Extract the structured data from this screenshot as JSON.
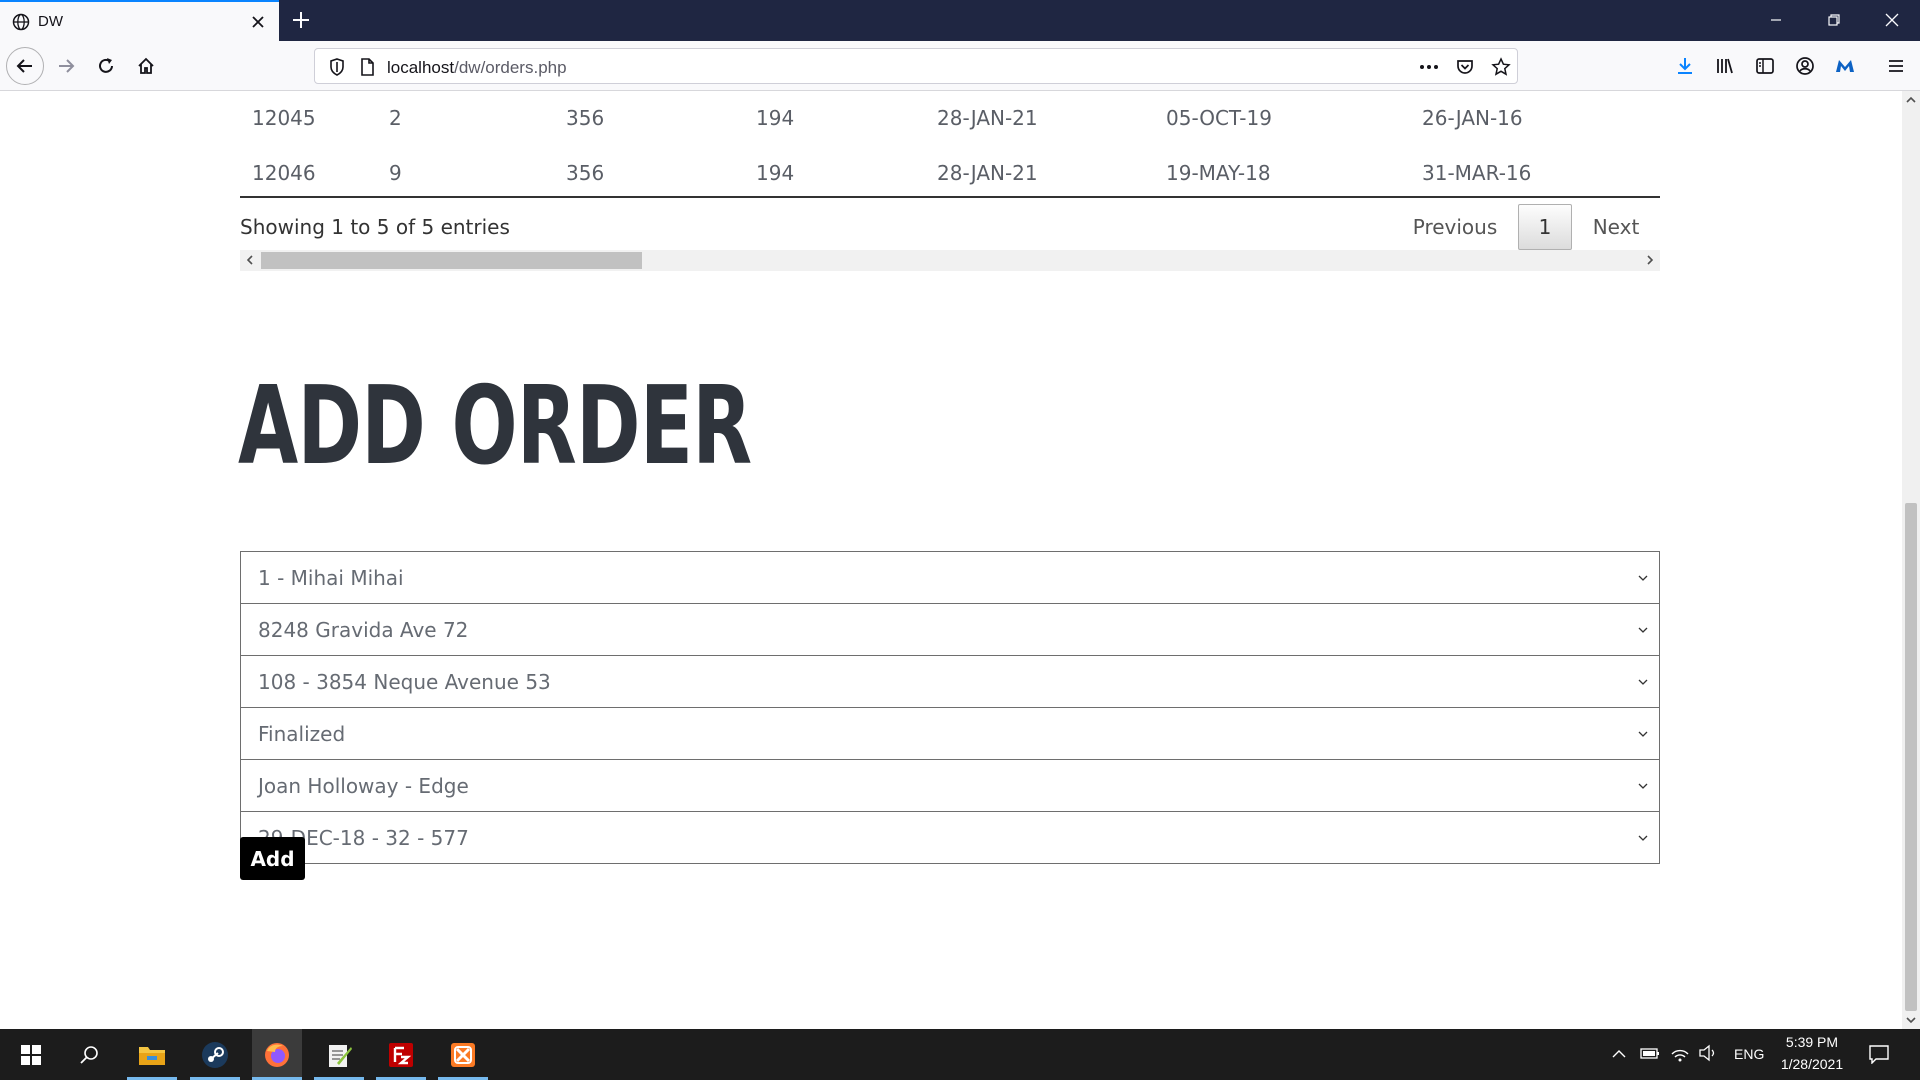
{
  "browser": {
    "tab_title": "DW",
    "url_host": "localhost",
    "url_path": "/dw/orders.php"
  },
  "table": {
    "rows": [
      [
        "12045",
        "2",
        "356",
        "194",
        "28-JAN-21",
        "05-OCT-19",
        "26-JAN-16"
      ],
      [
        "12046",
        "9",
        "356",
        "194",
        "28-JAN-21",
        "19-MAY-18",
        "31-MAR-16"
      ]
    ],
    "info": "Showing 1 to 5 of 5 entries",
    "pagination": {
      "previous": "Previous",
      "current": "1",
      "next": "Next"
    }
  },
  "form": {
    "heading": "ADD ORDER",
    "selects": [
      "1 - Mihai Mihai",
      "8248 Gravida Ave 72",
      "108 - 3854 Neque Avenue 53",
      "Finalized",
      "Joan Holloway - Edge",
      "29-DEC-18 - 32 - 577"
    ],
    "submit_label": "Add"
  },
  "taskbar": {
    "language": "ENG",
    "time": "5:39 PM",
    "date": "1/28/2021",
    "apps": [
      "windows-start",
      "search",
      "file-explorer",
      "steam",
      "firefox",
      "notepad-plus",
      "filezilla",
      "xampp"
    ]
  },
  "colors": {
    "tabbar": "#1f2642",
    "accent": "#0a84ff",
    "heading": "#2f343c",
    "button": "#000000"
  }
}
